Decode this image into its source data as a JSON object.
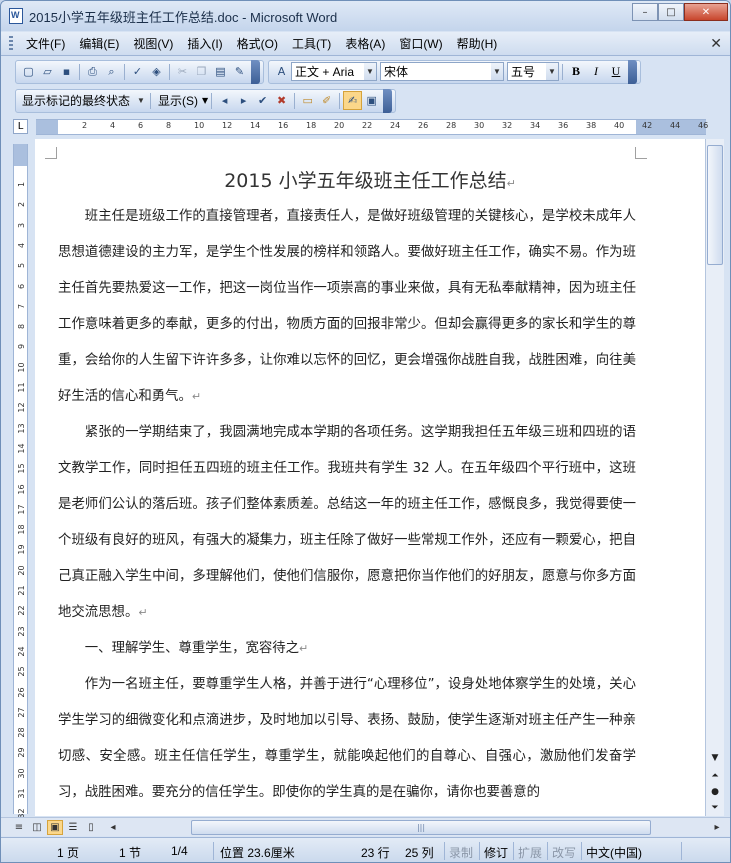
{
  "window": {
    "title": "2015小学五年级班主任工作总结.doc - Microsoft Word",
    "minimize": "–",
    "maximize": "□",
    "close": "✕"
  },
  "menu": {
    "items": [
      "文件(F)",
      "编辑(E)",
      "视图(V)",
      "插入(I)",
      "格式(O)",
      "工具(T)",
      "表格(A)",
      "窗口(W)",
      "帮助(H)"
    ],
    "close": "✕"
  },
  "formatting": {
    "style": "正文 + Aria",
    "font": "宋体",
    "size": "五号",
    "bold": "B",
    "italic": "I",
    "underline": "U"
  },
  "review": {
    "display_mode": "显示标记的最终状态",
    "show_menu": "显示(S)"
  },
  "ruler": {
    "h_ticks": [
      "2",
      "4",
      "6",
      "8",
      "10",
      "12",
      "14",
      "16",
      "18",
      "20",
      "22",
      "24",
      "26",
      "28",
      "30",
      "32",
      "34",
      "36",
      "38",
      "40",
      "42",
      "44",
      "46"
    ],
    "v_ticks": [
      "1",
      "2",
      "3",
      "4",
      "5",
      "6",
      "7",
      "8",
      "9",
      "10",
      "11",
      "12",
      "13",
      "14",
      "15",
      "16",
      "17",
      "18",
      "19",
      "20",
      "21",
      "22",
      "23",
      "24",
      "25",
      "26",
      "27",
      "28",
      "29",
      "30",
      "31",
      "32"
    ],
    "corner": "L"
  },
  "document": {
    "title": "2015 小学五年级班主任工作总结",
    "paragraphs": [
      "班主任是班级工作的直接管理者，直接责任人，是做好班级管理的关键核心，是学校未成年人思想道德建设的主力军，是学生个性发展的榜样和领路人。要做好班主任工作，确实不易。作为班主任首先要热爱这一工作，把这一岗位当作一项崇高的事业来做，具有无私奉献精神，因为班主任工作意味着更多的奉献，更多的付出，物质方面的回报非常少。但却会赢得更多的家长和学生的尊重，会给你的人生留下许许多多，让你难以忘怀的回忆，更会增强你战胜自我，战胜困难，向往美好生活的信心和勇气。",
      "紧张的一学期结束了，我圆满地完成本学期的各项任务。这学期我担任五年级三班和四班的语文教学工作，同时担任五四班的班主任工作。我班共有学生 32 人。在五年级四个平行班中，这班是老师们公认的落后班。孩子们整体素质差。总结这一年的班主任工作，感慨良多，我觉得要使一个班级有良好的班风，有强大的凝集力，班主任除了做好一些常规工作外，还应有一颗爱心，把自己真正融入学生中间，多理解他们，使他们信服你，愿意把你当作他们的好朋友，愿意与你多方面地交流思想。",
      "一、理解学生、尊重学生，宽容待之",
      "作为一名班主任，要尊重学生人格，并善于进行“心理移位”，设身处地体察学生的处境，关心学生学习的细微变化和点滴进步，及时地加以引导、表扬、鼓励，使学生逐渐对班主任产生一种亲切感、安全感。班主任信任学生，尊重学生，就能唤起他们的自尊心、自强心，激励他们发奋学习，战胜困难。要充分的信任学生。即使你的学生真的是在骗你，请你也要善意的"
    ],
    "para_mark": "↵"
  },
  "status": {
    "page": "1 页",
    "section": "1 节",
    "page_of": "1/4",
    "position": "位置 23.6厘米",
    "line": "23 行",
    "column": "25 列",
    "rec": "录制",
    "trk": "修订",
    "ext": "扩展",
    "ovr": "改写",
    "language": "中文(中国)"
  }
}
